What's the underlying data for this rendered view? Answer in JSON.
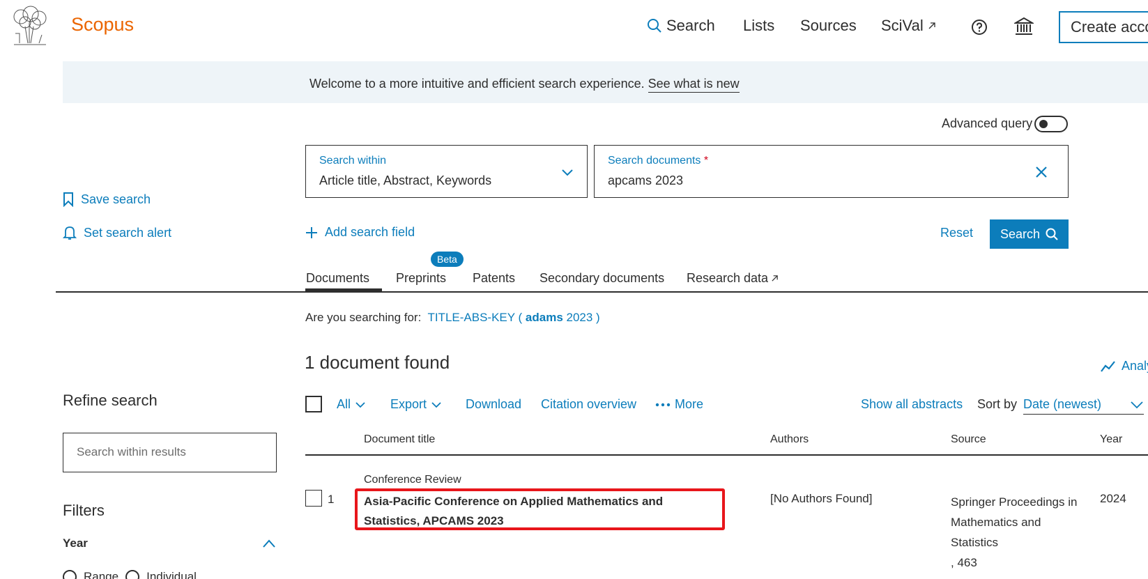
{
  "header": {
    "brand": "Scopus",
    "nav": [
      "Search",
      "Lists",
      "Sources",
      "SciVal"
    ],
    "create_account": "Create acco"
  },
  "banner": {
    "text": "Welcome to a more intuitive and efficient search experience.",
    "link": "See what is new"
  },
  "advanced_query": {
    "label": "Advanced query",
    "enabled": false
  },
  "search": {
    "within_label": "Search within",
    "within_value": "Article title, Abstract, Keywords",
    "docs_label": "Search documents",
    "docs_required": "*",
    "docs_value": "apcams 2023",
    "add_field": "Add search field",
    "reset": "Reset",
    "search_button": "Search"
  },
  "left": {
    "save_search": "Save search",
    "set_alert": "Set search alert",
    "refine": "Refine search",
    "search_within_placeholder": "Search within results",
    "filters": "Filters",
    "year": "Year",
    "range": "Range",
    "individual": "Individual"
  },
  "tabs": {
    "documents": "Documents",
    "preprints": "Preprints",
    "beta": "Beta",
    "patents": "Patents",
    "secondary": "Secondary documents",
    "research": "Research data"
  },
  "suggestion": {
    "prefix": "Are you searching for:",
    "query_a": "TITLE-ABS-KEY (",
    "query_b": "adams",
    "query_c": "2023 )"
  },
  "results": {
    "found": "1 document found",
    "analyze": "Analy"
  },
  "toolbar": {
    "all": "All",
    "export": "Export",
    "download": "Download",
    "citation": "Citation overview",
    "more": "More",
    "show_abstracts": "Show all abstracts",
    "sort_by": "Sort by",
    "sort_value": "Date (newest)"
  },
  "table": {
    "headers": [
      "Document title",
      "Authors",
      "Source",
      "Year"
    ],
    "rows": [
      {
        "number": "1",
        "type": "Conference Review",
        "title": "Asia-Pacific Conference on Applied Mathematics and Statistics, APCAMS 2023",
        "authors": "[No Authors Found]",
        "source": "Springer Proceedings in Mathematics and Statistics",
        "source_volume": ", 463",
        "year": "2024"
      }
    ]
  }
}
